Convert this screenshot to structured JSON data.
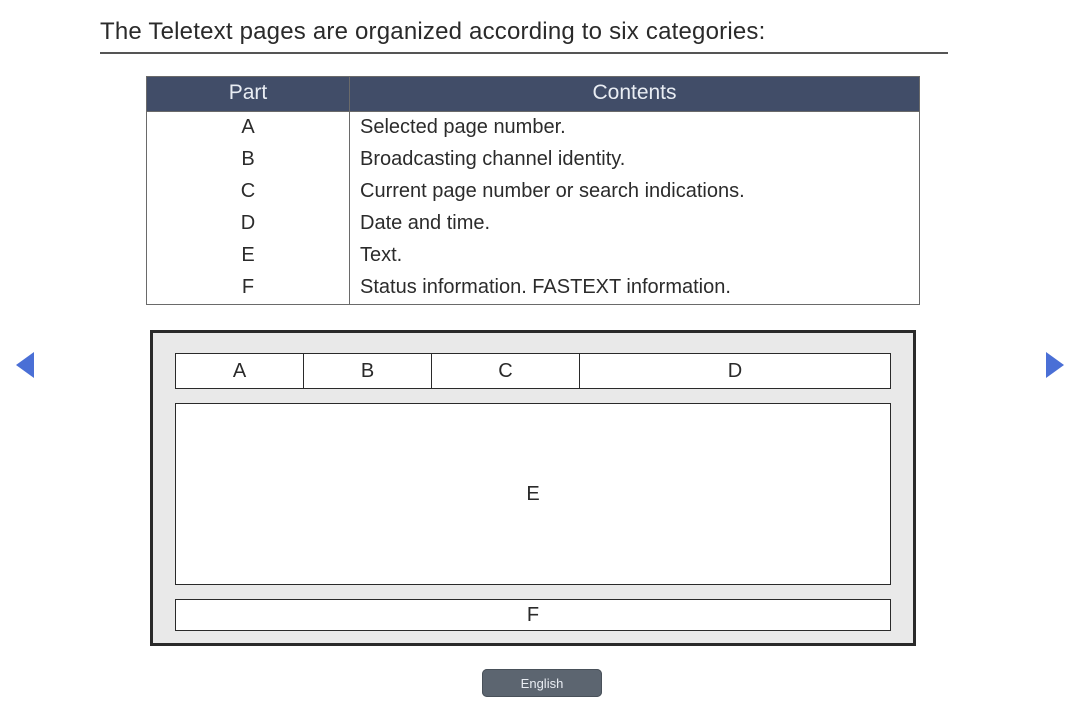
{
  "title": "The Teletext pages are organized according to six categories:",
  "table": {
    "headers": {
      "part": "Part",
      "contents": "Contents"
    },
    "rows": [
      {
        "part": "A",
        "contents": "Selected page number."
      },
      {
        "part": "B",
        "contents": "Broadcasting channel identity."
      },
      {
        "part": "C",
        "contents": "Current page number or search indications."
      },
      {
        "part": "D",
        "contents": "Date and time."
      },
      {
        "part": "E",
        "contents": "Text."
      },
      {
        "part": "F",
        "contents": "Status information. FASTEXT information."
      }
    ]
  },
  "diagram": {
    "top": {
      "A": "A",
      "B": "B",
      "C": "C",
      "D": "D"
    },
    "E": "E",
    "F": "F"
  },
  "language_label": "English"
}
